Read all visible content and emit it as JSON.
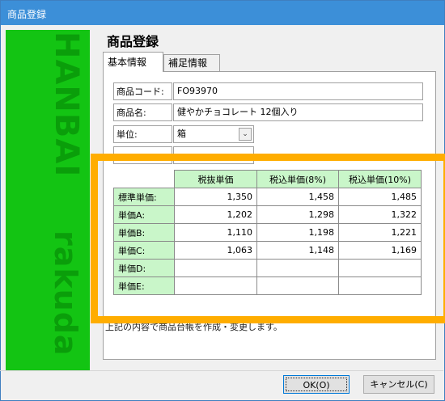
{
  "window": {
    "title": "商品登録"
  },
  "sidebar": {
    "text_top": "HANBAI",
    "text_bottom": "rakuda"
  },
  "heading": "商品登録",
  "tabs": [
    {
      "label": "基本情報",
      "active": true
    },
    {
      "label": "補足情報",
      "active": false
    }
  ],
  "fields": [
    {
      "label": "商品コード:",
      "value": "FO93970"
    },
    {
      "label": "商品名:",
      "value": "健やかチョコレート 12個入り"
    },
    {
      "label": "単位:",
      "value": "箱"
    },
    {
      "label": "",
      "value": ""
    }
  ],
  "price_table": {
    "columns": [
      "税抜単価",
      "税込単価(8%)",
      "税込単価(10%)"
    ],
    "rows": [
      {
        "label": "標準単価:",
        "values": [
          "1,350",
          "1,458",
          "1,485"
        ]
      },
      {
        "label": "単価A:",
        "values": [
          "1,202",
          "1,298",
          "1,322"
        ]
      },
      {
        "label": "単価B:",
        "values": [
          "1,110",
          "1,198",
          "1,221"
        ]
      },
      {
        "label": "単価C:",
        "values": [
          "1,063",
          "1,148",
          "1,169"
        ]
      },
      {
        "label": "単価D:",
        "values": [
          "",
          "",
          ""
        ]
      },
      {
        "label": "単価E:",
        "values": [
          "",
          "",
          ""
        ]
      }
    ]
  },
  "note": "上記の内容で商品台帳を作成・変更します。",
  "buttons": {
    "ok": "OK(O)",
    "cancel": "キャンセル(C)"
  },
  "colors": {
    "sidebar": "#13c413",
    "highlight": "#ffad00",
    "header_cell": "#c9f6c9",
    "titlebar": "#3c8fd8"
  },
  "icons": {
    "dropdown": "chevron-down-icon"
  }
}
